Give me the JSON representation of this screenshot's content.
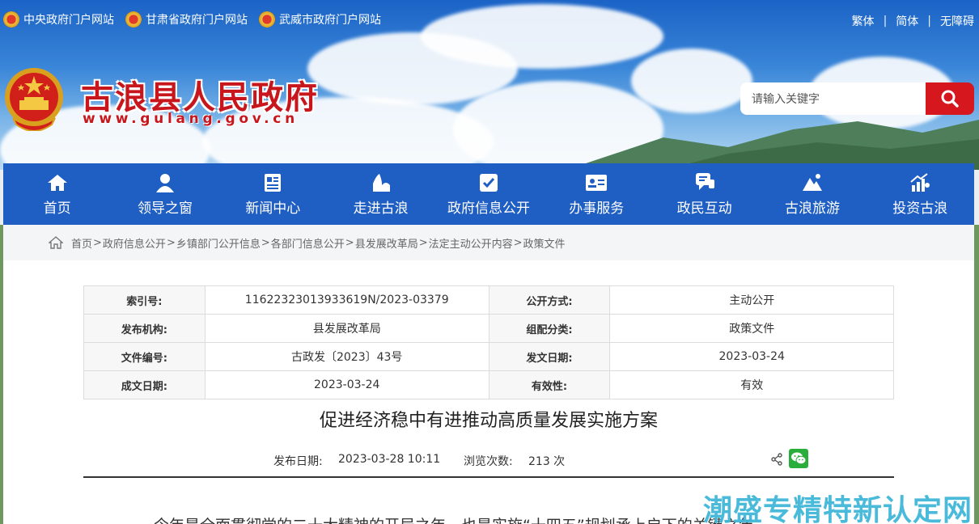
{
  "top_links": [
    "中央政府门户网站",
    "甘肃省政府门户网站",
    "武威市政府门户网站"
  ],
  "lang_links": [
    "繁体",
    "简体",
    "无障碍"
  ],
  "site": {
    "title": "古浪县人民政府",
    "url": "www.gulang.gov.cn"
  },
  "search": {
    "placeholder": "请输入关键字"
  },
  "nav": [
    {
      "label": "首页",
      "icon": "home-icon"
    },
    {
      "label": "领导之窗",
      "icon": "person-icon"
    },
    {
      "label": "新闻中心",
      "icon": "news-icon"
    },
    {
      "label": "走进古浪",
      "icon": "landmark-icon"
    },
    {
      "label": "政府信息公开",
      "icon": "info-check-icon"
    },
    {
      "label": "办事服务",
      "icon": "id-card-icon"
    },
    {
      "label": "政民互动",
      "icon": "chat-icon"
    },
    {
      "label": "古浪旅游",
      "icon": "mountain-icon"
    },
    {
      "label": "投资古浪",
      "icon": "growth-chart-icon"
    }
  ],
  "breadcrumb": [
    "首页",
    "政府信息公开",
    "乡镇部门公开信息",
    "各部门信息公开",
    "县发展改革局",
    "法定主动公开内容",
    "政策文件"
  ],
  "meta": {
    "index_label": "索引号:",
    "index_value": "11622323013933619N/2023-03379",
    "open_label": "公开方式:",
    "open_value": "主动公开",
    "org_label": "发布机构:",
    "org_value": "县发展改革局",
    "category_label": "组配分类:",
    "category_value": "政策文件",
    "docno_label": "文件编号:",
    "docno_value": "古政发〔2023〕43号",
    "issue_label": "发文日期:",
    "issue_value": "2023-03-24",
    "written_label": "成文日期:",
    "written_value": "2023-03-24",
    "valid_label": "有效性:",
    "valid_value": "有效"
  },
  "article": {
    "title": "促进经济稳中有进推动高质量发展实施方案",
    "publish_label": "发布日期:",
    "publish_value": "2023-03-28 10:11",
    "views_label": "浏览次数:",
    "views_value": "213 次",
    "first_line": "今年是全面贯彻党的二十大精神的开局之年，也是实施“十四五”规划承上启下的关键之年"
  },
  "watermark": "潮盛专精特新认定网",
  "colors": {
    "nav": "#1f5ec2",
    "title_red": "#c8161d",
    "search_red": "#d7171e"
  }
}
